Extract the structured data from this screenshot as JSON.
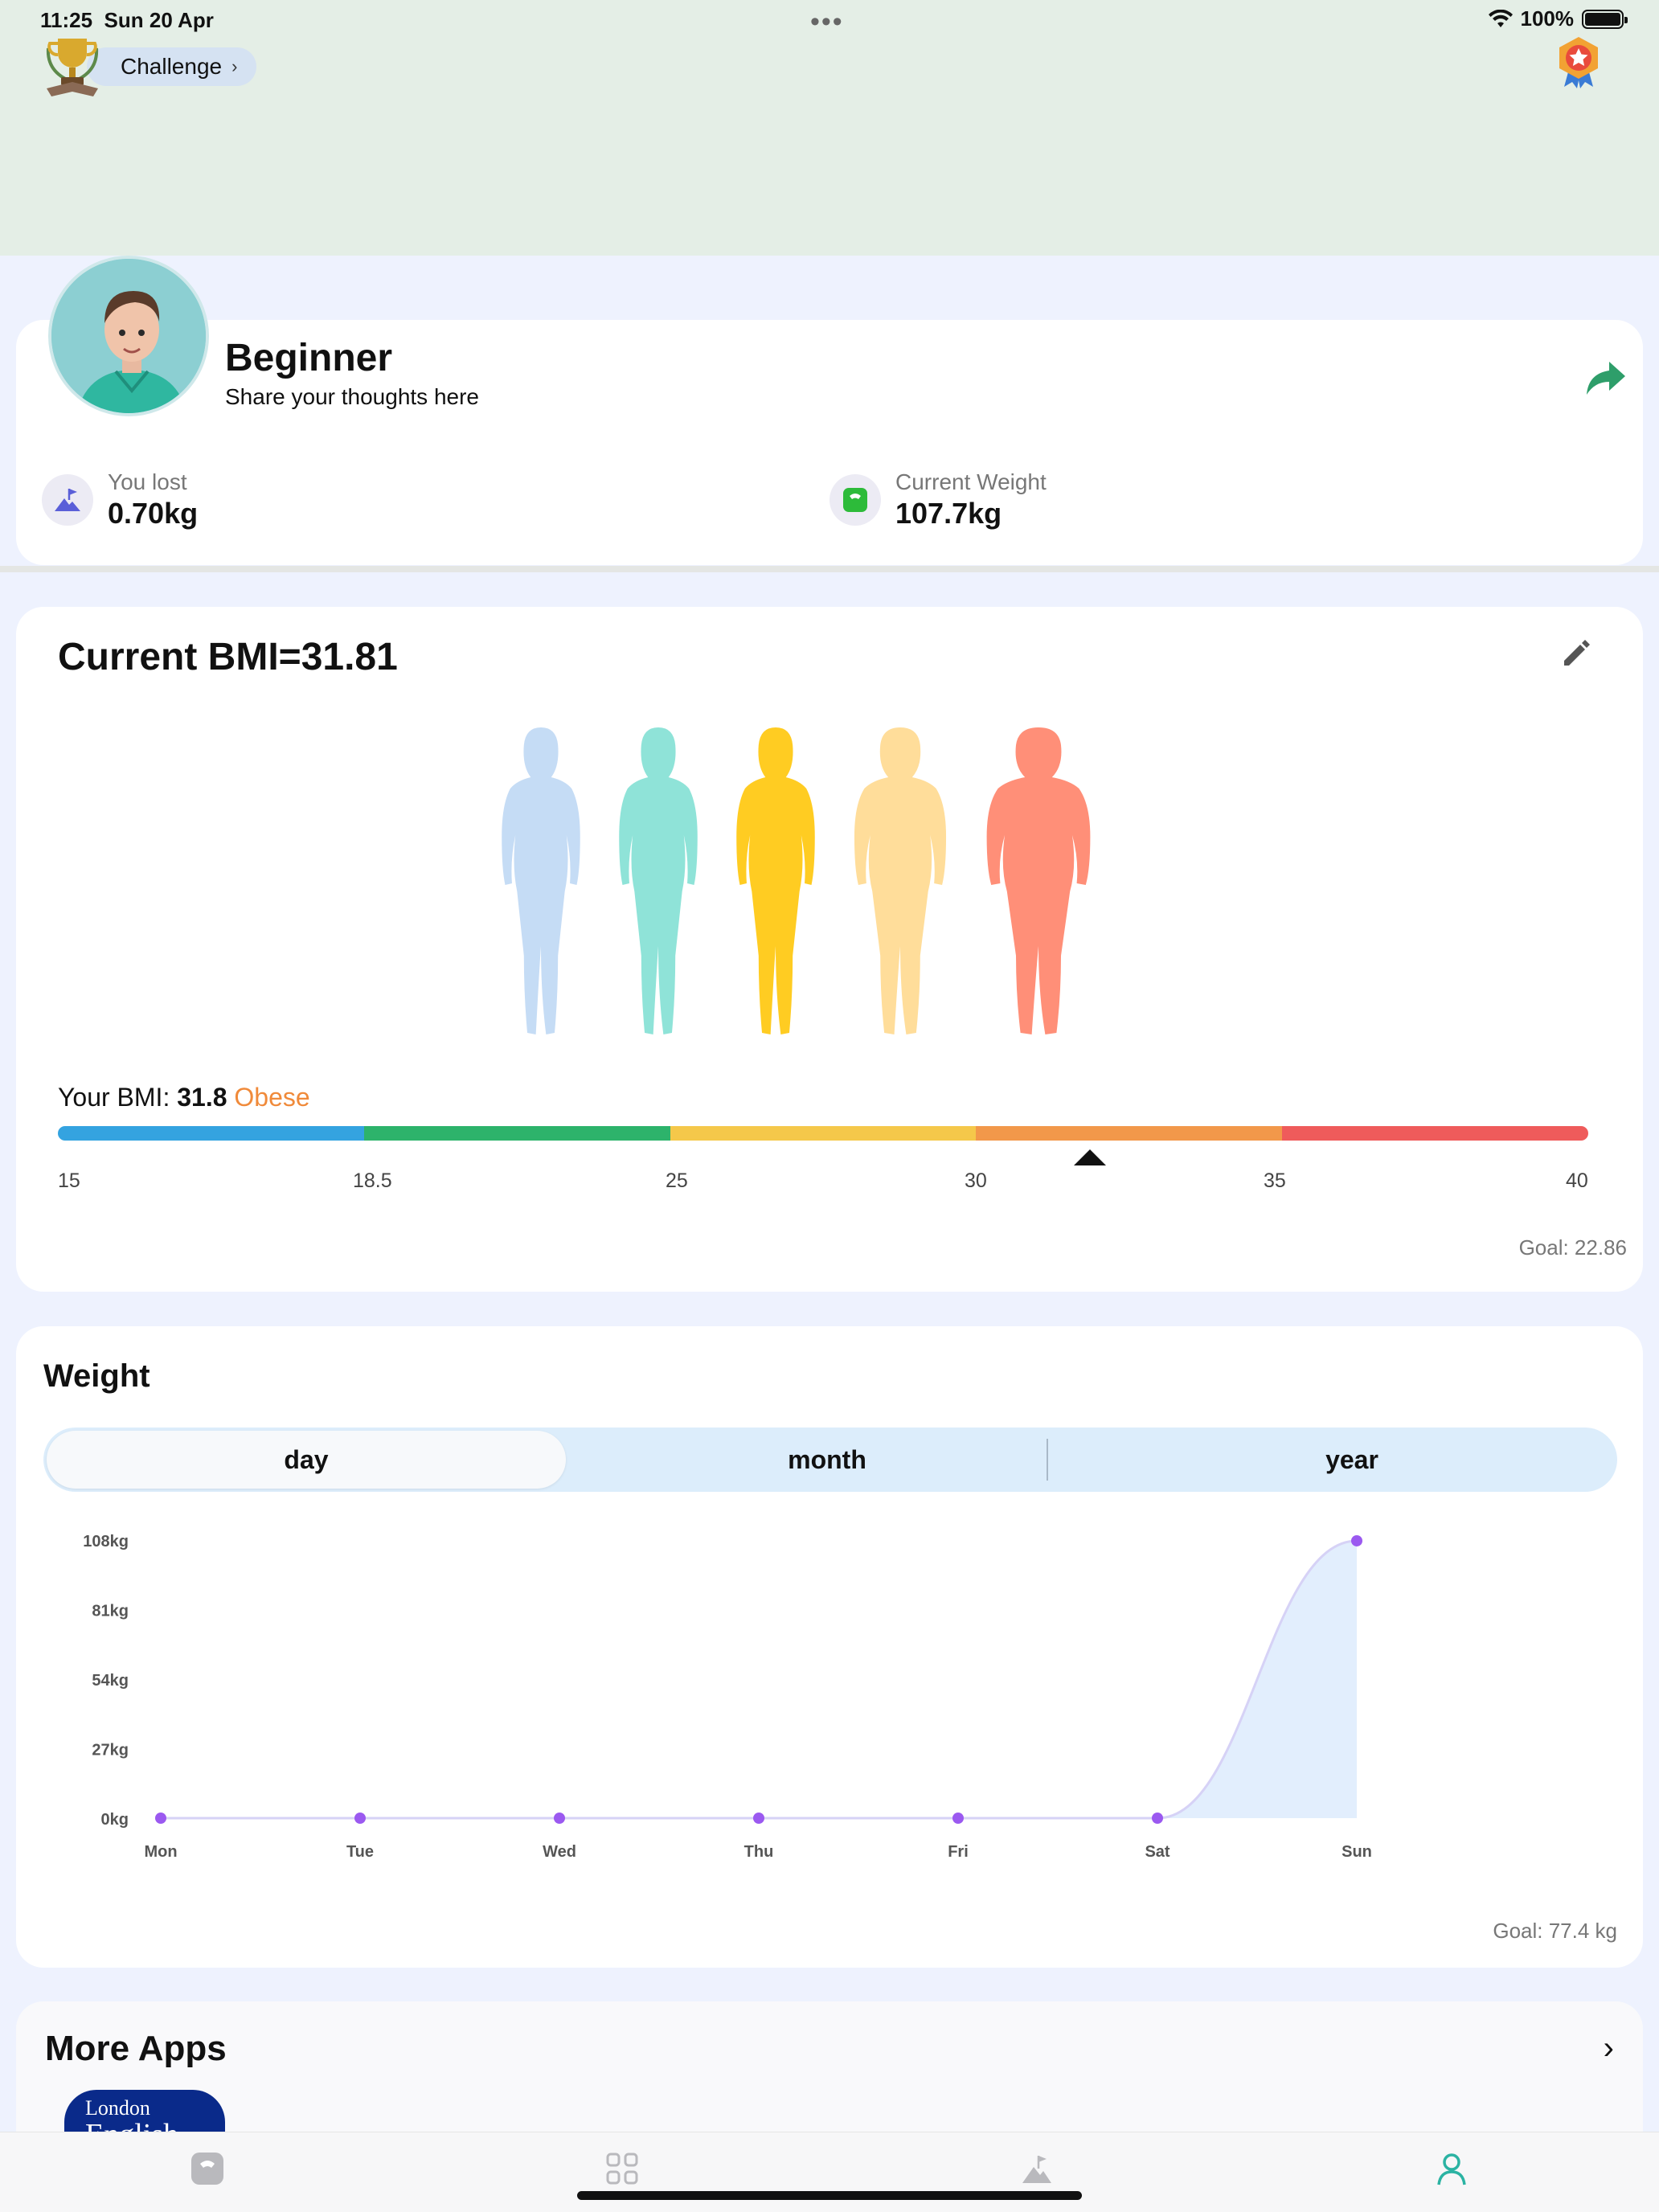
{
  "status_bar": {
    "time": "11:25",
    "date": "Sun 20 Apr",
    "battery": "100%"
  },
  "header": {
    "challenge_label": "Challenge",
    "icons": [
      "trophy-icon",
      "star-badge-icon"
    ]
  },
  "profile": {
    "level": "Beginner",
    "subtitle": "Share your thoughts here",
    "stats": [
      {
        "label": "You lost",
        "value": "0.70kg",
        "icon": "mountain-flag-icon"
      },
      {
        "label": "Current Weight",
        "value": "107.7kg",
        "icon": "scale-icon"
      }
    ]
  },
  "bmi": {
    "title": "Current BMI=31.81",
    "your_bmi_label": "Your BMI:",
    "your_bmi_value": "31.8",
    "category": "Obese",
    "ticks": [
      "15",
      "18.5",
      "25",
      "30",
      "35",
      "40"
    ],
    "goal": "Goal: 22.86",
    "marker_value": 31.8,
    "segment_colors": [
      "#34a3e0",
      "#2db36b",
      "#f5c84a",
      "#f2984a",
      "#ef5b5b"
    ],
    "figure_colors": [
      "#c5dcf5",
      "#8fe3d8",
      "#ffcc22",
      "#ffdd9a",
      "#ff8f78"
    ]
  },
  "weight": {
    "title": "Weight",
    "tabs": [
      "day",
      "month",
      "year"
    ],
    "active_tab": "day",
    "goal": "Goal: 77.4 kg"
  },
  "chart_data": {
    "type": "area",
    "categories": [
      "Mon",
      "Tue",
      "Wed",
      "Thu",
      "Fri",
      "Sat",
      "Sun"
    ],
    "values": [
      0,
      0,
      0,
      0,
      0,
      0,
      107.7
    ],
    "y_ticks": [
      "108kg",
      "81kg",
      "54kg",
      "27kg",
      "0kg"
    ],
    "ylim": [
      0,
      108
    ],
    "color": "#9b59f0"
  },
  "more_apps": {
    "title": "More Apps",
    "app_line1": "London",
    "app_line2": "English"
  },
  "tabbar": {
    "tabs": [
      "scale-tab-icon",
      "grid-tab-icon",
      "mountain-tab-icon",
      "profile-tab-icon"
    ],
    "active_color": "#2bb3a3"
  }
}
